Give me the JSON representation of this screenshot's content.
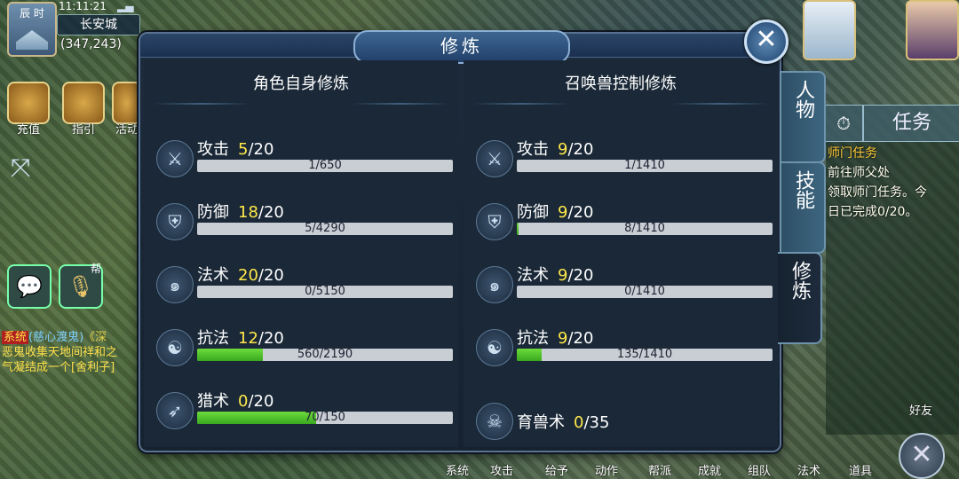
{
  "hud": {
    "time_label": "辰 时",
    "clock": "11:11:21",
    "city": "长安城",
    "coords": "(347,243)",
    "left_icons": [
      "充值",
      "指引",
      "活动"
    ],
    "voice_tag": "帮"
  },
  "chat": {
    "line1_tag": "系统",
    "line1_name": "(慈心渡鬼)",
    "line1_rest": "《深",
    "line2": "恶鬼收集天地间祥和之",
    "line3": "气凝结成一个[舍利子]"
  },
  "quest": {
    "tab": "任务",
    "timer_icon": "clock-icon",
    "lines": [
      "师门任务",
      "前往师父处",
      "领取师门任务。今",
      "日已完成0/20。"
    ]
  },
  "panel": {
    "title": "修炼",
    "close": "✕",
    "left_title": "角色自身修炼",
    "right_title": "召唤兽控制修炼",
    "left_rows": [
      {
        "name": "攻击",
        "cur": "5",
        "max": "/20",
        "bar": "1/650",
        "fill": 0.0015,
        "icon": "sword-icon",
        "glyph": "⚔"
      },
      {
        "name": "防御",
        "cur": "18",
        "max": "/20",
        "bar": "5/4290",
        "fill": 0.0012,
        "icon": "shield-icon",
        "glyph": "⛨"
      },
      {
        "name": "法术",
        "cur": "20",
        "max": "/20",
        "bar": "0/5150",
        "fill": 0.0,
        "icon": "magic-swirl-icon",
        "glyph": "๑"
      },
      {
        "name": "抗法",
        "cur": "12",
        "max": "/20",
        "bar": "560/2190",
        "fill": 0.2557,
        "icon": "yin-yang-icon",
        "glyph": "☯"
      },
      {
        "name": "猎术",
        "cur": "0",
        "max": "/20",
        "bar": "70/150",
        "fill": 0.4667,
        "icon": "bow-icon",
        "glyph": "➶"
      }
    ],
    "right_rows": [
      {
        "name": "攻击",
        "cur": "9",
        "max": "/20",
        "bar": "1/1410",
        "fill": 0.0007,
        "icon": "sword-icon",
        "glyph": "⚔"
      },
      {
        "name": "防御",
        "cur": "9",
        "max": "/20",
        "bar": "8/1410",
        "fill": 0.0057,
        "icon": "shield-icon",
        "glyph": "⛨"
      },
      {
        "name": "法术",
        "cur": "9",
        "max": "/20",
        "bar": "0/1410",
        "fill": 0.0,
        "icon": "magic-swirl-icon",
        "glyph": "๑"
      },
      {
        "name": "抗法",
        "cur": "9",
        "max": "/20",
        "bar": "135/1410",
        "fill": 0.0957,
        "icon": "yin-yang-icon",
        "glyph": "☯"
      }
    ],
    "beast": {
      "name": "育兽术",
      "cur": "0",
      "max": "/35",
      "icon": "skull-icon",
      "glyph": "☠"
    }
  },
  "side_tabs": [
    {
      "label": "人物",
      "active": false
    },
    {
      "label": "技能",
      "active": false
    },
    {
      "label": "修炼",
      "active": true
    }
  ],
  "bottom_bar": [
    "系统",
    "攻击",
    "给予",
    "动作",
    "帮派",
    "成就",
    "组队",
    "法术",
    "道具"
  ],
  "friends_label": "好友"
}
